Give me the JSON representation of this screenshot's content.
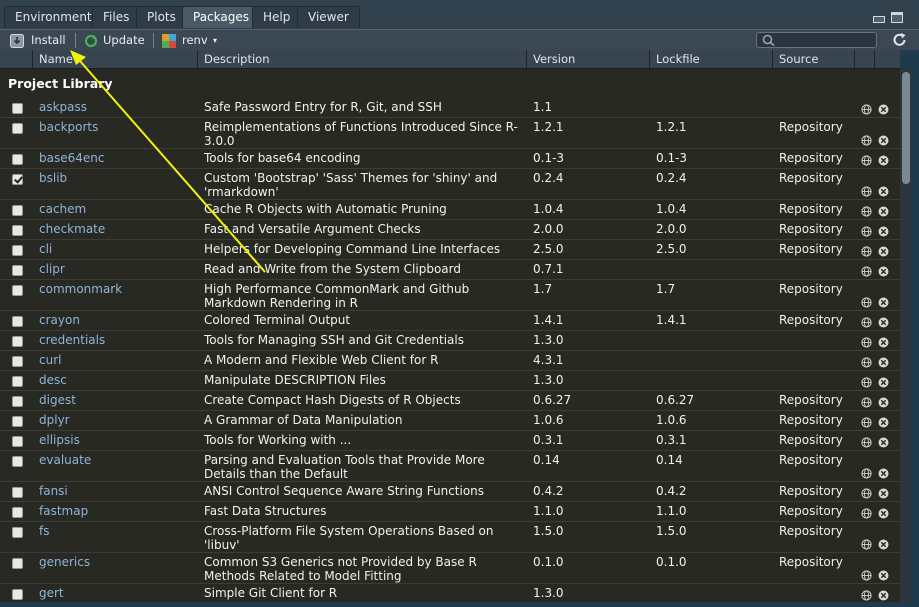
{
  "tabs": [
    "Environment",
    "Files",
    "Plots",
    "Packages",
    "Help",
    "Viewer"
  ],
  "active_tab": "Packages",
  "toolbar": {
    "install_label": "Install",
    "update_label": "Update",
    "renv_label": "renv",
    "search_placeholder": ""
  },
  "columns": [
    "Name",
    "Description",
    "Version",
    "Lockfile",
    "Source"
  ],
  "section_title": "Project Library",
  "packages": [
    {
      "name": "askpass",
      "desc": "Safe Password Entry for R, Git, and SSH",
      "version": "1.1",
      "lockfile": "",
      "source": "",
      "checked": false
    },
    {
      "name": "backports",
      "desc": "Reimplementations of Functions Introduced Since R-3.0.0",
      "version": "1.2.1",
      "lockfile": "1.2.1",
      "source": "Repository",
      "checked": false
    },
    {
      "name": "base64enc",
      "desc": "Tools for base64 encoding",
      "version": "0.1-3",
      "lockfile": "0.1-3",
      "source": "Repository",
      "checked": false
    },
    {
      "name": "bslib",
      "desc": "Custom 'Bootstrap' 'Sass' Themes for 'shiny' and 'rmarkdown'",
      "version": "0.2.4",
      "lockfile": "0.2.4",
      "source": "Repository",
      "checked": true
    },
    {
      "name": "cachem",
      "desc": "Cache R Objects with Automatic Pruning",
      "version": "1.0.4",
      "lockfile": "1.0.4",
      "source": "Repository",
      "checked": false
    },
    {
      "name": "checkmate",
      "desc": "Fast and Versatile Argument Checks",
      "version": "2.0.0",
      "lockfile": "2.0.0",
      "source": "Repository",
      "checked": false
    },
    {
      "name": "cli",
      "desc": "Helpers for Developing Command Line Interfaces",
      "version": "2.5.0",
      "lockfile": "2.5.0",
      "source": "Repository",
      "checked": false
    },
    {
      "name": "clipr",
      "desc": "Read and Write from the System Clipboard",
      "version": "0.7.1",
      "lockfile": "",
      "source": "",
      "checked": false
    },
    {
      "name": "commonmark",
      "desc": "High Performance CommonMark and Github Markdown Rendering in R",
      "version": "1.7",
      "lockfile": "1.7",
      "source": "Repository",
      "checked": false
    },
    {
      "name": "crayon",
      "desc": "Colored Terminal Output",
      "version": "1.4.1",
      "lockfile": "1.4.1",
      "source": "Repository",
      "checked": false
    },
    {
      "name": "credentials",
      "desc": "Tools for Managing SSH and Git Credentials",
      "version": "1.3.0",
      "lockfile": "",
      "source": "",
      "checked": false
    },
    {
      "name": "curl",
      "desc": "A Modern and Flexible Web Client for R",
      "version": "4.3.1",
      "lockfile": "",
      "source": "",
      "checked": false
    },
    {
      "name": "desc",
      "desc": "Manipulate DESCRIPTION Files",
      "version": "1.3.0",
      "lockfile": "",
      "source": "",
      "checked": false
    },
    {
      "name": "digest",
      "desc": "Create Compact Hash Digests of R Objects",
      "version": "0.6.27",
      "lockfile": "0.6.27",
      "source": "Repository",
      "checked": false
    },
    {
      "name": "dplyr",
      "desc": "A Grammar of Data Manipulation",
      "version": "1.0.6",
      "lockfile": "1.0.6",
      "source": "Repository",
      "checked": false
    },
    {
      "name": "ellipsis",
      "desc": "Tools for Working with ...",
      "version": "0.3.1",
      "lockfile": "0.3.1",
      "source": "Repository",
      "checked": false
    },
    {
      "name": "evaluate",
      "desc": "Parsing and Evaluation Tools that Provide More Details than the Default",
      "version": "0.14",
      "lockfile": "0.14",
      "source": "Repository",
      "checked": false
    },
    {
      "name": "fansi",
      "desc": "ANSI Control Sequence Aware String Functions",
      "version": "0.4.2",
      "lockfile": "0.4.2",
      "source": "Repository",
      "checked": false
    },
    {
      "name": "fastmap",
      "desc": "Fast Data Structures",
      "version": "1.1.0",
      "lockfile": "1.1.0",
      "source": "Repository",
      "checked": false
    },
    {
      "name": "fs",
      "desc": "Cross-Platform File System Operations Based on 'libuv'",
      "version": "1.5.0",
      "lockfile": "1.5.0",
      "source": "Repository",
      "checked": false
    },
    {
      "name": "generics",
      "desc": "Common S3 Generics not Provided by Base R Methods Related to Model Fitting",
      "version": "0.1.0",
      "lockfile": "0.1.0",
      "source": "Repository",
      "checked": false
    },
    {
      "name": "gert",
      "desc": "Simple Git Client for R",
      "version": "1.3.0",
      "lockfile": "",
      "source": "",
      "checked": false
    }
  ],
  "colors": {
    "annotation_arrow": "#f2f20a",
    "package_link": "#8fb4d8",
    "table_background": "#282923"
  }
}
